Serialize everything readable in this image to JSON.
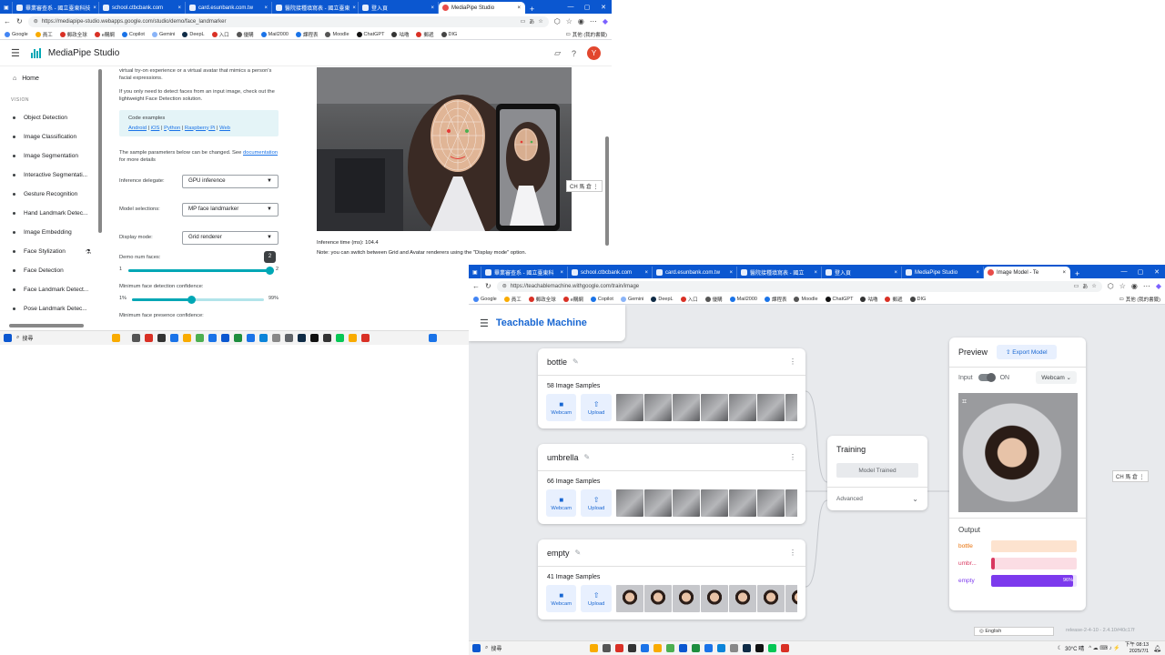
{
  "win1": {
    "tabs": [
      "畢業審查系 - 國立臺東科技",
      "school.ctbcbank.com",
      "card.esunbank.com.tw",
      "醫院接種填寫表 - 國立臺東",
      "登入頁",
      "MediaPipe Studio"
    ],
    "url": "https://mediapipe-studio.webapps.google.com/studio/demo/face_landmarker",
    "bookmarks": [
      "Google",
      "員工",
      "郵政全球",
      "e購網",
      "Copilot",
      "Gemini",
      "DeepL",
      "入口",
      "優購",
      "Mail2000",
      "課程表",
      "Moodle",
      "ChatGPT",
      "咕嚕",
      "郵遞",
      "DIG"
    ],
    "bookmarks_right": "其他 (我的書籤)",
    "app_title": "MediaPipe Studio",
    "avatar_letter": "Y",
    "sidebar": {
      "home": "Home",
      "section": "VISION",
      "items": [
        "Object Detection",
        "Image Classification",
        "Image Segmentation",
        "Interactive Segmentati...",
        "Gesture Recognition",
        "Hand Landmark Detec...",
        "Image Embedding",
        "Face Stylization",
        "Face Detection",
        "Face Landmark Detect...",
        "Pose Landmark Detec..."
      ]
    },
    "main": {
      "intro": "virtual try-on experience or a virtual avatar that mimics a person's facial expressions.",
      "detect_note": "If you only need to detect faces from an input image, check out the lightweight Face Detection solution.",
      "code_title": "Code examples",
      "code_links": [
        "Android",
        "iOS",
        "Python",
        "Raspberry Pi",
        "Web"
      ],
      "params_note_a": "The sample parameters below can be changed. See",
      "params_link": "documentation",
      "params_note_b": "for more details",
      "delegate_label": "Inference delegate:",
      "delegate_value": "GPU inference",
      "model_label": "Model selections:",
      "model_value": "MP face landmarker",
      "display_label": "Display mode:",
      "display_value": "Grid renderer",
      "num_faces_label": "Demo num faces:",
      "num_faces_min": "1",
      "num_faces_max": "2",
      "num_faces_value": "2",
      "num_faces_level": 1.0,
      "det_conf_label": "Minimum face detection confidence:",
      "det_conf_min": "1%",
      "det_conf_max": "99%",
      "det_conf_level": 0.45,
      "presence_label": "Minimum face presence confidence:"
    },
    "inference_time": "Inference time (ms): 104.4",
    "renderer_note": "Note: you can switch between Grid and Avatar renderers using the \"Display mode\" option.",
    "ime": "CH 馬 倉 ⋮",
    "search": "搜尋"
  },
  "win2": {
    "tabs": [
      "畢業審查系 - 國立臺東科",
      "school.ctbcbank.com",
      "card.esunbank.com.tw",
      "醫院接種填寫表 - 國立",
      "登入頁",
      "MediaPipe Studio",
      "Image Model - Te"
    ],
    "url": "https://teachablemachine.withgoogle.com/train/image",
    "bookmarks": [
      "Google",
      "員工",
      "郵政全球",
      "e購網",
      "Copilot",
      "Gemini",
      "DeepL",
      "入口",
      "優購",
      "Mail2000",
      "課程表",
      "Moodle",
      "ChatGPT",
      "咕嚕",
      "郵遞",
      "DIG"
    ],
    "bookmarks_right": "其他 (我的書籤)",
    "app_title": "Teachable Machine",
    "classes": [
      {
        "name": "bottle",
        "samples": "58 Image Samples",
        "thumb_style": "object"
      },
      {
        "name": "umbrella",
        "samples": "66 Image Samples",
        "thumb_style": "object"
      },
      {
        "name": "empty",
        "samples": "41 Image Samples",
        "thumb_style": "person"
      }
    ],
    "webcam_label": "Webcam",
    "upload_label": "Upload",
    "training_title": "Training",
    "training_button": "Model Trained",
    "advanced_label": "Advanced",
    "preview_title": "Preview",
    "export_label": "Export Model",
    "input_label": "Input",
    "input_state": "ON",
    "webcam_select": "Webcam",
    "output_title": "Output",
    "outputs": [
      {
        "label": "bottle",
        "color": "#e8710a",
        "track": "#fde3cf",
        "level": 0.0,
        "pct": ""
      },
      {
        "label": "umbr...",
        "color": "#d93860",
        "track": "#fbdde4",
        "level": 0.04,
        "pct": ""
      },
      {
        "label": "empty",
        "color": "#7c3aed",
        "track": "#ece4fd",
        "level": 0.96,
        "pct": "96%"
      }
    ],
    "language": "English",
    "release": "release-2-4-10 - 2.4.10#40c17f",
    "ime": "CH 馬 倉 ⋮",
    "search": "搜尋",
    "weather": "30°C 晴",
    "clock_time": "下午 08:13",
    "clock_date": "2025/7/1"
  }
}
